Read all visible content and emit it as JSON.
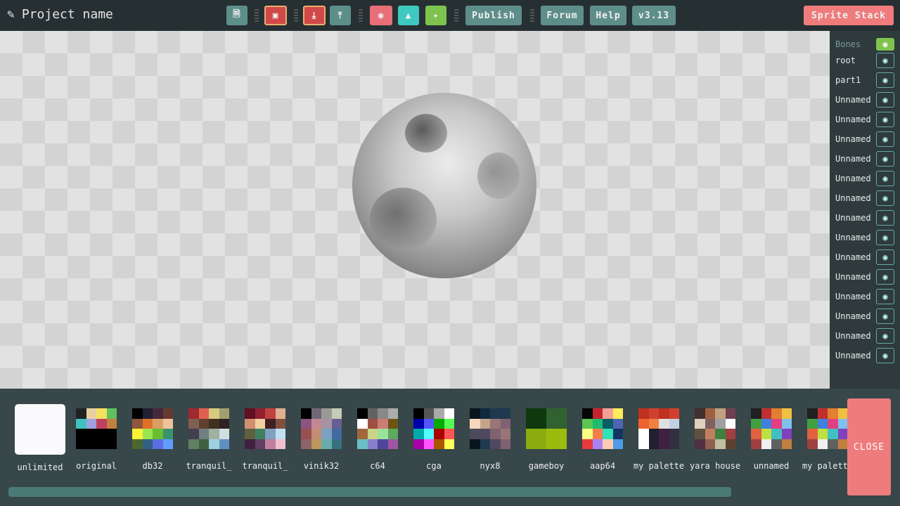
{
  "header": {
    "project_name": "Project name",
    "publish": "Publish",
    "forum": "Forum",
    "help": "Help",
    "version": "v3.13",
    "sprite_stack": "Sprite Stack"
  },
  "toolbar_icons": [
    "new-file-icon",
    "save-icon",
    "download-icon",
    "upload-icon",
    "turtle-icon",
    "cat-icon",
    "bird-icon"
  ],
  "bones": {
    "header": "Bones",
    "items": [
      "root",
      "part1",
      "Unnamed",
      "Unnamed",
      "Unnamed",
      "Unnamed",
      "Unnamed",
      "Unnamed",
      "Unnamed",
      "Unnamed",
      "Unnamed",
      "Unnamed",
      "Unnamed",
      "Unnamed",
      "Unnamed",
      "Unnamed"
    ]
  },
  "palettes": [
    {
      "name": "unlimited",
      "colors": []
    },
    {
      "name": "original",
      "colors": [
        "#222",
        "#e8d0a0",
        "#f4e060",
        "#60c060",
        "#40c0c0",
        "#a0a0e0",
        "#c04060",
        "#c08040",
        "#000",
        "#000",
        "#000",
        "#000",
        "#000",
        "#000",
        "#000",
        "#000"
      ]
    },
    {
      "name": "db32",
      "colors": [
        "#000",
        "#222034",
        "#45283c",
        "#663931",
        "#8f563b",
        "#df7126",
        "#d9a066",
        "#eec39a",
        "#fbf236",
        "#99e550",
        "#6abe30",
        "#37946e",
        "#4b692f",
        "#306082",
        "#5b6ee1",
        "#639bff"
      ]
    },
    {
      "name": "tranquil_",
      "colors": [
        "#a02830",
        "#e06050",
        "#d8c880",
        "#a0a070",
        "#806050",
        "#604030",
        "#403020",
        "#302020",
        "#404050",
        "#708080",
        "#a0b0a0",
        "#d0e0e0",
        "#608060",
        "#406040",
        "#a0d0e0",
        "#6090c0"
      ]
    },
    {
      "name": "tranquil_",
      "colors": [
        "#601020",
        "#902030",
        "#c04040",
        "#e0b090",
        "#d09070",
        "#f0d0a0",
        "#402020",
        "#805040",
        "#606040",
        "#408060",
        "#80a0c0",
        "#c0e0f0",
        "#402040",
        "#604060",
        "#c080a0",
        "#f0c0d0"
      ]
    },
    {
      "name": "vinik32",
      "colors": [
        "#000",
        "#6f6776",
        "#9a9a97",
        "#c5ccb8",
        "#8b5580",
        "#c38890",
        "#a593a5",
        "#666092",
        "#9a4f50",
        "#c28d75",
        "#7ca1c0",
        "#416aa3",
        "#8d6268",
        "#be955c",
        "#68aca9",
        "#387080"
      ]
    },
    {
      "name": "c64",
      "colors": [
        "#000",
        "#626262",
        "#898989",
        "#adadad",
        "#fff",
        "#9f4e44",
        "#cb7e75",
        "#6d5412",
        "#a1683c",
        "#c9d487",
        "#9ae29b",
        "#5cab5e",
        "#6abfc6",
        "#887ecb",
        "#50459b",
        "#a057a3"
      ]
    },
    {
      "name": "cga",
      "colors": [
        "#000",
        "#555",
        "#aaa",
        "#fff",
        "#0000aa",
        "#5555ff",
        "#00aa00",
        "#55ff55",
        "#00aaaa",
        "#55ffff",
        "#aa0000",
        "#ff5555",
        "#aa00aa",
        "#ff55ff",
        "#aa5500",
        "#ffff55"
      ]
    },
    {
      "name": "nyx8",
      "colors": [
        "#08141e",
        "#0f2a3f",
        "#20394f",
        "#20394f",
        "#f6d6bd",
        "#c3a38a",
        "#997577",
        "#816271",
        "#4e495f",
        "#4e495f",
        "#816271",
        "#997577",
        "#08141e",
        "#20394f",
        "#4e495f",
        "#816271"
      ]
    },
    {
      "name": "gameboy",
      "colors": [
        "#0f380f",
        "#0f380f",
        "#306230",
        "#306230",
        "#0f380f",
        "#0f380f",
        "#306230",
        "#306230",
        "#8bac0f",
        "#8bac0f",
        "#9bbc0f",
        "#9bbc0f",
        "#8bac0f",
        "#8bac0f",
        "#9bbc0f",
        "#9bbc0f"
      ]
    },
    {
      "name": "aap64",
      "colors": [
        "#060608",
        "#c42430",
        "#f5a097",
        "#ffeb57",
        "#5ac54f",
        "#1ebc73",
        "#0b5e65",
        "#4d65b4",
        "#fbff86",
        "#f57d4a",
        "#30e1b9",
        "#143464",
        "#e83b3b",
        "#a884f3",
        "#fdcbb0",
        "#4d9be6"
      ]
    },
    {
      "name": "my palette",
      "colors": [
        "#c03020",
        "#d04030",
        "#c03020",
        "#d04030",
        "#f06030",
        "#f08040",
        "#e0e0e0",
        "#c0d0e0",
        "#fff",
        "#202030",
        "#402040",
        "#303040",
        "#fff",
        "#202030",
        "#402040",
        "#303040"
      ]
    },
    {
      "name": "yara house",
      "colors": [
        "#403030",
        "#a06040",
        "#c0a080",
        "#704050",
        "#e0d0c0",
        "#806060",
        "#a0a0a0",
        "#fff",
        "#605040",
        "#c08060",
        "#408040",
        "#a04040",
        "#503040",
        "#906050",
        "#c0c0a0",
        "#604030"
      ]
    },
    {
      "name": "unnamed",
      "colors": [
        "#202020",
        "#c03030",
        "#e08030",
        "#f0c040",
        "#40a040",
        "#4080e0",
        "#e04080",
        "#80c0f0",
        "#e06040",
        "#c0e040",
        "#40c0c0",
        "#8040c0",
        "#a04040",
        "#f0f0f0",
        "#606060",
        "#c08040"
      ]
    },
    {
      "name": "my palette",
      "colors": [
        "#202020",
        "#c03030",
        "#e08030",
        "#f0c040",
        "#40a040",
        "#4080e0",
        "#e04080",
        "#80c0f0",
        "#e06040",
        "#c0e040",
        "#40c0c0",
        "#8040c0",
        "#a04040",
        "#f0f0f0",
        "#606060",
        "#c08040"
      ]
    }
  ],
  "close": "CLOSE"
}
